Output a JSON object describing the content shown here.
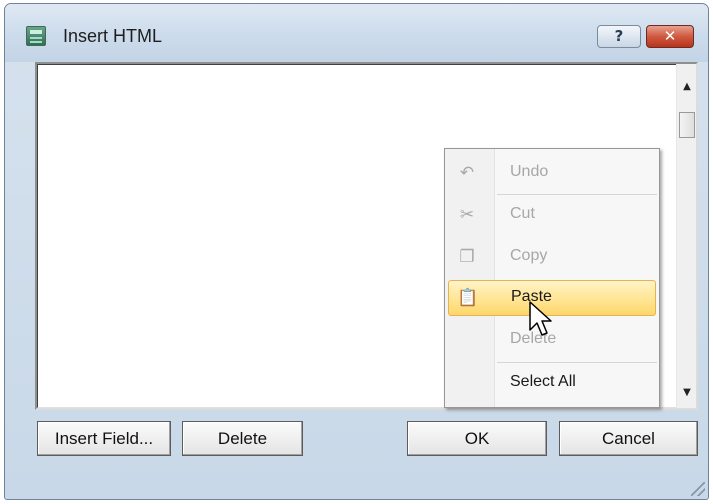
{
  "window": {
    "title": "Insert HTML",
    "help_label": "?",
    "close_label": "✕"
  },
  "editor": {
    "content": ""
  },
  "scrollbar": {
    "up": "▲",
    "down": "▼"
  },
  "context_menu": {
    "items": [
      {
        "label": "Undo",
        "icon": "undo-icon",
        "glyph": "↶",
        "enabled": false
      },
      {
        "label": "Cut",
        "icon": "cut-icon",
        "glyph": "✂",
        "enabled": false
      },
      {
        "label": "Copy",
        "icon": "copy-icon",
        "glyph": "❐",
        "enabled": false
      },
      {
        "label": "Paste",
        "icon": "paste-icon",
        "glyph": "📋",
        "enabled": true,
        "highlighted": true
      },
      {
        "label": "Delete",
        "icon": "",
        "glyph": "",
        "enabled": false
      },
      {
        "label": "Select All",
        "icon": "",
        "glyph": "",
        "enabled": true
      }
    ]
  },
  "buttons": {
    "insert_field": "Insert Field...",
    "delete": "Delete",
    "ok": "OK",
    "cancel": "Cancel"
  },
  "colors": {
    "menu_highlight": "#ffe89c",
    "close_button": "#cf5a40",
    "disabled_text": "#a7a7a7"
  }
}
